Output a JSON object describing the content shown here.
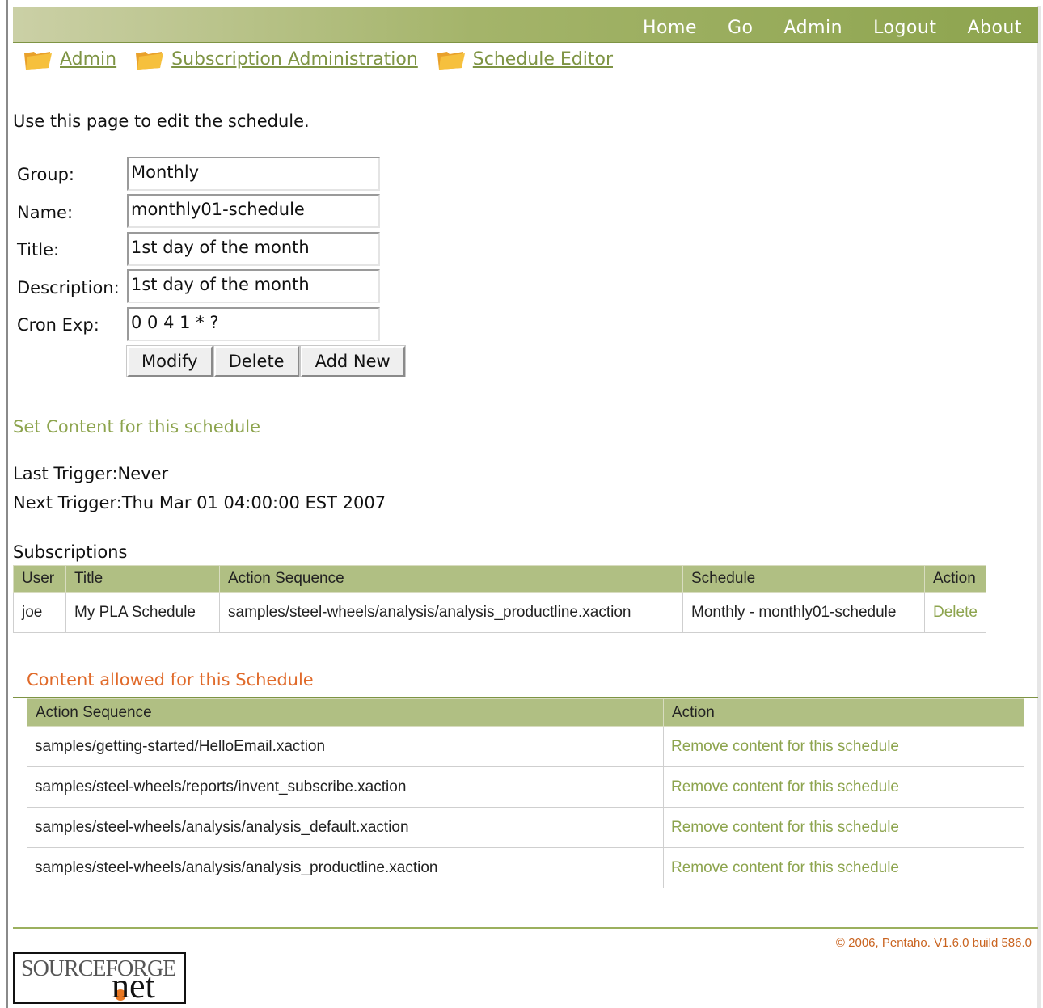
{
  "topnav": {
    "items": [
      "Home",
      "Go",
      "Admin",
      "Logout",
      "About"
    ]
  },
  "breadcrumb": {
    "items": [
      {
        "label": "Admin",
        "icon": "folder-icon"
      },
      {
        "label": "Subscription Administration",
        "icon": "folder-icon"
      },
      {
        "label": "Schedule Editor",
        "icon": "folder-icon"
      }
    ]
  },
  "intro": "Use this page to edit the schedule.",
  "form": {
    "group_label": "Group:",
    "group_value": "Monthly",
    "name_label": "Name:",
    "name_value": "monthly01-schedule",
    "title_label": "Title:",
    "title_value": "1st day of the month",
    "description_label": "Description:",
    "description_value": "1st day of the month",
    "cron_label": "Cron Exp:",
    "cron_value": "0 0 4 1 * ?",
    "buttons": {
      "modify": "Modify",
      "delete": "Delete",
      "add_new": "Add New"
    }
  },
  "set_content_link": "Set Content for this schedule",
  "triggers": {
    "last": "Last Trigger:Never",
    "next": "Next Trigger:Thu Mar 01 04:00:00 EST 2007"
  },
  "subscriptions": {
    "title": "Subscriptions",
    "headers": [
      "User",
      "Title",
      "Action Sequence",
      "Schedule",
      "Action"
    ],
    "rows": [
      {
        "user": "joe",
        "title": "My PLA Schedule",
        "action_sequence": "samples/steel-wheels/analysis/analysis_productline.xaction",
        "schedule": "Monthly - monthly01-schedule",
        "action": "Delete"
      }
    ]
  },
  "allowed_content": {
    "title": "Content allowed for this Schedule",
    "headers": [
      "Action Sequence",
      "Action"
    ],
    "rows": [
      {
        "sequence": "samples/getting-started/HelloEmail.xaction",
        "action": "Remove content for this schedule"
      },
      {
        "sequence": "samples/steel-wheels/reports/invent_subscribe.xaction",
        "action": "Remove content for this schedule"
      },
      {
        "sequence": "samples/steel-wheels/analysis/analysis_default.xaction",
        "action": "Remove content for this schedule"
      },
      {
        "sequence": "samples/steel-wheels/analysis/analysis_productline.xaction",
        "action": "Remove content for this schedule"
      }
    ]
  },
  "footer": {
    "copyright": "© 2006, Pentaho. V1.6.0 build 586.0",
    "logo_text_top": "SOURCEFORGE",
    "logo_text_bottom": "net"
  },
  "colors": {
    "accent_green": "#8da44e",
    "header_green": "#b0bf83",
    "orange": "#e06a2a"
  }
}
